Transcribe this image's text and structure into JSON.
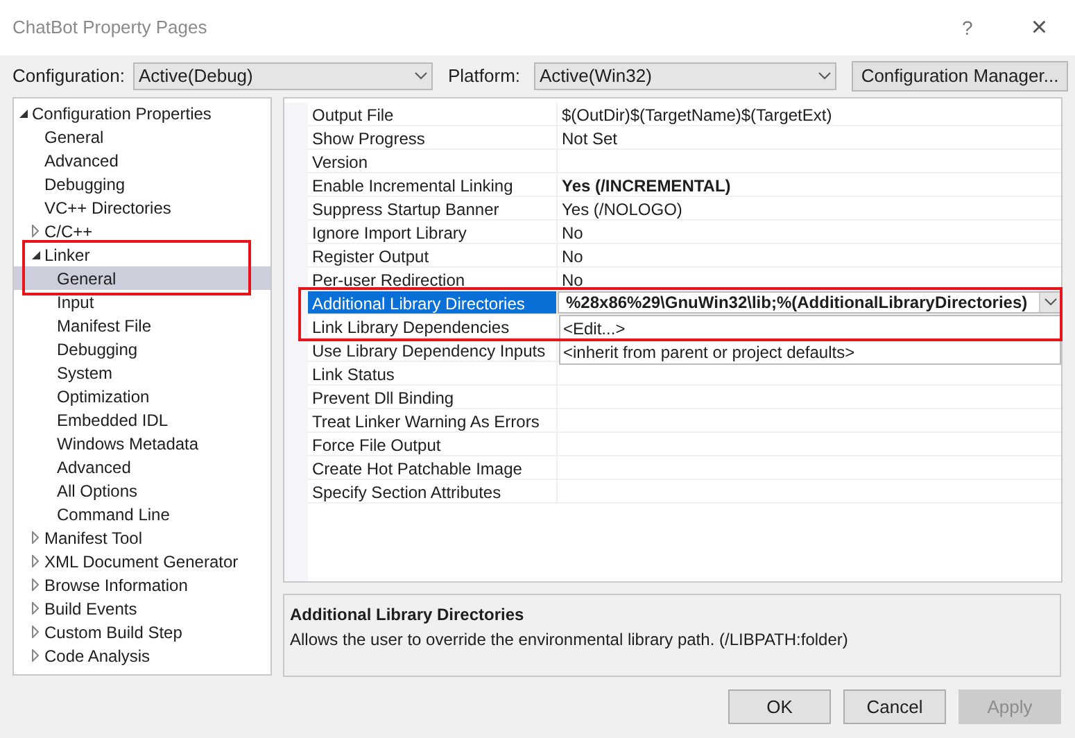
{
  "window": {
    "title": "ChatBot Property Pages",
    "help": "?",
    "close": "×"
  },
  "toolbar": {
    "configuration_label": "Configuration:",
    "configuration": "Active(Debug)",
    "platform_label": "Platform:",
    "platform": "Active(Win32)",
    "manager_button": "Configuration Manager..."
  },
  "tree": [
    {
      "label": "Configuration Properties",
      "expanded": true,
      "selected": false,
      "children": [
        {
          "label": "General",
          "selected": false
        },
        {
          "label": "Advanced",
          "selected": false
        },
        {
          "label": "Debugging",
          "selected": false
        },
        {
          "label": "VC++ Directories",
          "selected": false
        },
        {
          "label": "C/C++",
          "expanded": false,
          "selected": false
        },
        {
          "label": "Linker",
          "expanded": true,
          "selected": false,
          "highlight": true,
          "children": [
            {
              "label": "General",
              "selected": true
            },
            {
              "label": "Input",
              "selected": false
            },
            {
              "label": "Manifest File",
              "selected": false
            },
            {
              "label": "Debugging",
              "selected": false
            },
            {
              "label": "System",
              "selected": false
            },
            {
              "label": "Optimization",
              "selected": false
            },
            {
              "label": "Embedded IDL",
              "selected": false
            },
            {
              "label": "Windows Metadata",
              "selected": false
            },
            {
              "label": "Advanced",
              "selected": false
            },
            {
              "label": "All Options",
              "selected": false
            },
            {
              "label": "Command Line",
              "selected": false
            }
          ]
        },
        {
          "label": "Manifest Tool",
          "expanded": false,
          "selected": false
        },
        {
          "label": "XML Document Generator",
          "expanded": false,
          "selected": false
        },
        {
          "label": "Browse Information",
          "expanded": false,
          "selected": false
        },
        {
          "label": "Build Events",
          "expanded": false,
          "selected": false
        },
        {
          "label": "Custom Build Step",
          "expanded": false,
          "selected": false
        },
        {
          "label": "Code Analysis",
          "expanded": false,
          "selected": false
        }
      ]
    }
  ],
  "properties": [
    {
      "name": "Output File",
      "value": "$(OutDir)$(TargetName)$(TargetExt)",
      "bold": false,
      "selected": false
    },
    {
      "name": "Show Progress",
      "value": "Not Set",
      "bold": false,
      "selected": false
    },
    {
      "name": "Version",
      "selected": false
    },
    {
      "name": "Enable Incremental Linking",
      "value": "Yes (/INCREMENTAL)",
      "bold": true,
      "selected": false
    },
    {
      "name": "Suppress Startup Banner",
      "value": "Yes (/NOLOGO)",
      "bold": false,
      "selected": false
    },
    {
      "name": "Ignore Import Library",
      "value": "No",
      "bold": false,
      "selected": false
    },
    {
      "name": "Register Output",
      "value": "No",
      "bold": false,
      "selected": false
    },
    {
      "name": "Per-user Redirection",
      "value": "No",
      "bold": false,
      "selected": false
    },
    {
      "name": "Additional Library Directories",
      "value": "%28x86%29\\GnuWin32\\lib;%(AdditionalLibraryDirectories)",
      "bold": true,
      "selected": true,
      "highlight": true,
      "dropdown": [
        "<Edit...>",
        "<inherit from parent or project defaults>"
      ]
    },
    {
      "name": "Link Library Dependencies",
      "selected": false
    },
    {
      "name": "Use Library Dependency Inputs",
      "selected": false
    },
    {
      "name": "Link Status",
      "selected": false
    },
    {
      "name": "Prevent Dll Binding",
      "selected": false
    },
    {
      "name": "Treat Linker Warning As Errors",
      "selected": false
    },
    {
      "name": "Force File Output",
      "selected": false
    },
    {
      "name": "Create Hot Patchable Image",
      "selected": false
    },
    {
      "name": "Specify Section Attributes",
      "selected": false
    }
  ],
  "description": {
    "title": "Additional Library Directories",
    "text": "Allows the user to override the environmental library path. (/LIBPATH:folder)"
  },
  "buttons": [
    {
      "label": "OK",
      "disabled": false
    },
    {
      "label": "Cancel",
      "disabled": false
    },
    {
      "label": "Apply",
      "disabled": true
    }
  ]
}
